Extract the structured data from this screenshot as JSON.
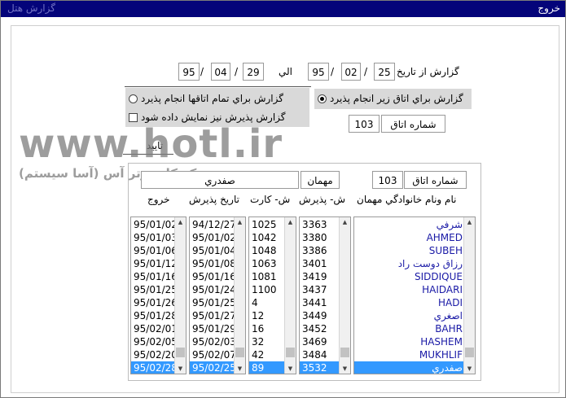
{
  "window": {
    "title": "خروج",
    "caption_left": "گزارش هتل"
  },
  "report": {
    "from_label": "گزارش از تاريخ",
    "to_label": "الي",
    "from_date": {
      "day": "25",
      "month": "02",
      "year": "95"
    },
    "to_date": {
      "day": "29",
      "month": "04",
      "year": "95"
    }
  },
  "options": {
    "single_room_label": "گزارش براي اتاق زير انجام پذيرد",
    "all_rooms_label": "گزارش براي تمام اتاقها انجام پذيرد",
    "show_checkin_label": "گزارش پذيرش نيز نمايش داده شود",
    "single_room_selected": true,
    "show_checkin_checked": false
  },
  "room": {
    "label": "شماره اتاق",
    "value": "103"
  },
  "confirm_button": "تاييد",
  "detail": {
    "room_label": "شماره اتاق",
    "room_value": "103",
    "guest_label": "مهمان",
    "guest_value": "صفدري"
  },
  "watermark": {
    "url": "www.hotl.ir",
    "company": "مركز كامپيوتر آس (آسا سيستم)"
  },
  "columns": {
    "name": "نام ونام خانوادگي مهمان",
    "checkin_no": "ش- پذيرش",
    "card_no": "ش- كارت",
    "checkin_date": "تاريخ پذيرش",
    "checkout": "خروج"
  },
  "rows": [
    {
      "name": "شرفي",
      "checkin_no": "3363",
      "card": "1025",
      "date_in": "94/12/27",
      "date_out": "95/01/02"
    },
    {
      "name": "AHMED",
      "checkin_no": "3380",
      "card": "1042",
      "date_in": "95/01/02",
      "date_out": "95/01/03"
    },
    {
      "name": "SUBEH",
      "checkin_no": "3386",
      "card": "1048",
      "date_in": "95/01/04",
      "date_out": "95/01/06"
    },
    {
      "name": "رزاق دوست راد",
      "checkin_no": "3401",
      "card": "1063",
      "date_in": "95/01/08",
      "date_out": "95/01/12"
    },
    {
      "name": "SIDDIQUE",
      "checkin_no": "3419",
      "card": "1081",
      "date_in": "95/01/16",
      "date_out": "95/01/16"
    },
    {
      "name": "HAIDARI",
      "checkin_no": "3437",
      "card": "1100",
      "date_in": "95/01/24",
      "date_out": "95/01/25"
    },
    {
      "name": "HADI",
      "checkin_no": "3441",
      "card": "4",
      "date_in": "95/01/25",
      "date_out": "95/01/26"
    },
    {
      "name": "اصغري",
      "checkin_no": "3449",
      "card": "12",
      "date_in": "95/01/27",
      "date_out": "95/01/28"
    },
    {
      "name": "BAHR",
      "checkin_no": "3452",
      "card": "16",
      "date_in": "95/01/29",
      "date_out": "95/02/01"
    },
    {
      "name": "HASHEM",
      "checkin_no": "3469",
      "card": "32",
      "date_in": "95/02/03",
      "date_out": "95/02/05"
    },
    {
      "name": "MUKHLIF",
      "checkin_no": "3484",
      "card": "42",
      "date_in": "95/02/07",
      "date_out": "95/02/20"
    },
    {
      "name": "صفدري",
      "checkin_no": "3532",
      "card": "89",
      "date_in": "95/02/25",
      "date_out": "95/02/28"
    }
  ],
  "selected_row": 11,
  "colors": {
    "titlebar": "#04047a",
    "selection": "#3399ff",
    "name_text": "#1a1aa6",
    "panel": "#d9d9d9"
  }
}
